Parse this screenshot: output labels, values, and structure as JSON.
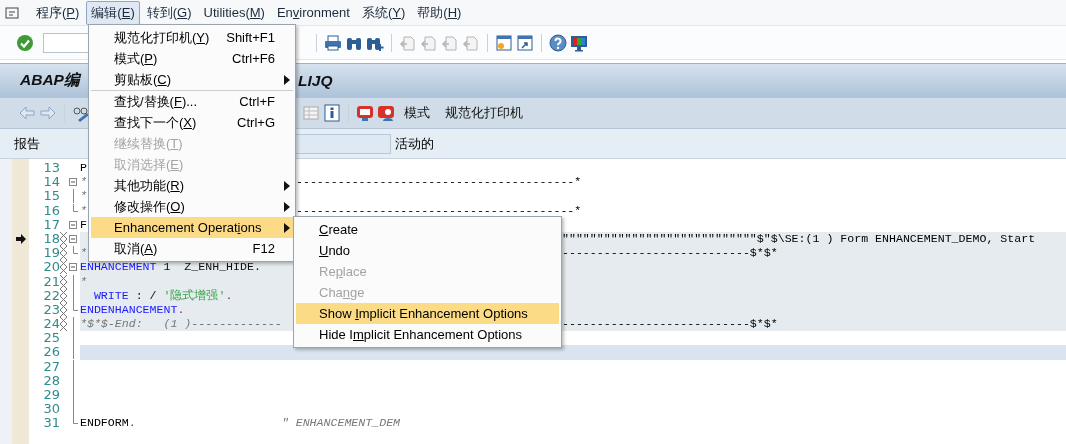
{
  "menu_bar": {
    "items": [
      {
        "before": "程序(",
        "key": "P",
        "after": ")",
        "selected": false
      },
      {
        "before": "编辑(",
        "key": "E",
        "after": ")",
        "selected": true
      },
      {
        "before": "转到(",
        "key": "G",
        "after": ")",
        "selected": false
      },
      {
        "before": "Utilities(",
        "key": "M",
        "after": ")",
        "selected": false
      },
      {
        "before": "En",
        "key": "v",
        "after": "ironment",
        "selected": false
      },
      {
        "before": "系统(",
        "key": "Y",
        "after": ")",
        "selected": false
      },
      {
        "before": "帮助(",
        "key": "H",
        "after": ")",
        "selected": false
      }
    ]
  },
  "title": {
    "start": "ABAP编",
    "end": "LIJQ"
  },
  "app_toolbar": {
    "buttons": [
      "模式",
      "规范化打印机"
    ]
  },
  "header": {
    "label": "报告",
    "status": "活动的"
  },
  "editor": {
    "lines": [
      {
        "number": "13",
        "segments": [
          {
            "text": "P",
            "kind": "bold"
          }
        ]
      },
      {
        "number": "14",
        "fold": {
          "kind": "open"
        },
        "segments": [
          {
            "text": "*",
            "kind": "comment"
          }
        ],
        "tail": {
          "text": "----------------------------------------*",
          "kind": "near"
        }
      },
      {
        "number": "15",
        "fold": {
          "kind": "line"
        },
        "segments": [
          {
            "text": "*",
            "kind": "comment"
          }
        ]
      },
      {
        "number": "16",
        "fold": {
          "kind": "end"
        },
        "segments": [
          {
            "text": "*",
            "kind": "comment"
          }
        ],
        "tail": {
          "text": "----------------------------------------*",
          "kind": "near"
        }
      },
      {
        "number": "17",
        "fold": {
          "kind": "open"
        },
        "segments": [
          {
            "text": "F",
            "kind": "bold"
          }
        ]
      },
      {
        "number": "18",
        "fold": {
          "kind": "open"
        },
        "marker": true,
        "enhancement": true,
        "tail": {
          "text": "\"\"\"\"\"\"\"\"\"\"\"\"\"\"\"\"\"\"\"\"\"\"\"\"\"\"\"\"$\"$\\SE:(1 ) Form ENHANCEMENT_DEMO, Start",
          "kind": "far"
        }
      },
      {
        "number": "19",
        "fold": {
          "kind": "end"
        },
        "enhancement": true,
        "segments": [
          {
            "text": "*",
            "kind": "comment"
          }
        ],
        "tail": {
          "text": "---------------------------$*$*",
          "kind": "far"
        }
      },
      {
        "number": "20",
        "fold": {
          "kind": "open"
        },
        "enhancement": true,
        "segments": [
          {
            "text": "ENHANCEMENT",
            "kind": "keyword"
          },
          {
            "text": " 1  Z_ENH_HIDE.",
            "kind": "plain"
          }
        ]
      },
      {
        "number": "21",
        "fold": {
          "kind": "line"
        },
        "enhancement": true,
        "segments": [
          {
            "text": "*",
            "kind": "comment"
          }
        ]
      },
      {
        "number": "22",
        "fold": {
          "kind": "line"
        },
        "enhancement": true,
        "segments": [
          {
            "text": "  WRITE",
            "kind": "keyword"
          },
          {
            "text": " : / ",
            "kind": "plain"
          },
          {
            "text": "'隐式增强'",
            "kind": "string"
          },
          {
            "text": ".",
            "kind": "punct"
          }
        ]
      },
      {
        "number": "23",
        "fold": {
          "kind": "end"
        },
        "enhancement": true,
        "segments": [
          {
            "text": "ENDENHANCEMENT",
            "kind": "keyword"
          },
          {
            "text": ".",
            "kind": "punct"
          }
        ]
      },
      {
        "number": "24",
        "fold": {
          "kind": "line"
        },
        "enhancement": true,
        "segments": [
          {
            "text": "*$*$-End:   (1 )-------------",
            "kind": "comment"
          }
        ],
        "tail": {
          "text": "---------------------------$*$*",
          "kind": "far"
        }
      },
      {
        "number": "25",
        "fold": {
          "kind": "line"
        }
      },
      {
        "number": "26",
        "fold": {
          "kind": "line"
        },
        "cursor": true
      },
      {
        "number": "27",
        "fold": {
          "kind": "line"
        }
      },
      {
        "number": "28",
        "fold": {
          "kind": "line"
        }
      },
      {
        "number": "29",
        "fold": {
          "kind": "line"
        }
      },
      {
        "number": "30",
        "fold": {
          "kind": "line"
        }
      },
      {
        "number": "31",
        "fold": {
          "kind": "end"
        },
        "segments": [
          {
            "text": "ENDFORM",
            "kind": "bold"
          },
          {
            "text": ".",
            "kind": "punct"
          },
          {
            "text": "                     \" ENHANCEMENT_DEM",
            "kind": "comment"
          }
        ]
      }
    ]
  },
  "edit_menu": {
    "groups": [
      [
        {
          "before": "规范化打印机(",
          "key": "Y",
          "after": ")",
          "shortcut": "Shift+F1",
          "has_submenu": false,
          "disabled": false,
          "selected": false
        },
        {
          "before": "模式(",
          "key": "P",
          "after": ")",
          "shortcut": "Ctrl+F6",
          "has_submenu": false,
          "disabled": false,
          "selected": false
        },
        {
          "before": "剪贴板(",
          "key": "C",
          "after": ")",
          "has_submenu": true,
          "disabled": false,
          "selected": false
        }
      ],
      [
        {
          "before": "查找/替换(",
          "key": "F",
          "after": ")...",
          "shortcut": "Ctrl+F",
          "has_submenu": false,
          "disabled": false,
          "selected": false
        },
        {
          "before": "查找下一个(",
          "key": "X",
          "after": ")",
          "shortcut": "Ctrl+G",
          "has_submenu": false,
          "disabled": false,
          "selected": false
        },
        {
          "before": "继续替换(",
          "key": "T",
          "after": ")",
          "has_submenu": false,
          "disabled": true,
          "selected": false
        },
        {
          "before": "取消选择(",
          "key": "E",
          "after": ")",
          "has_submenu": false,
          "disabled": true,
          "selected": false
        },
        {
          "before": "其他功能(",
          "key": "R",
          "after": ")",
          "has_submenu": true,
          "disabled": false,
          "selected": false
        },
        {
          "before": "修改操作(",
          "key": "O",
          "after": ")",
          "has_submenu": true,
          "disabled": false,
          "selected": false
        },
        {
          "before": "Enhancement Operat",
          "key": "i",
          "after": "ons",
          "has_submenu": true,
          "disabled": false,
          "selected": true
        },
        {
          "before": "取消(",
          "key": "A",
          "after": ")",
          "shortcut": "F12",
          "has_submenu": false,
          "disabled": false,
          "selected": false
        }
      ]
    ]
  },
  "submenu": {
    "items": [
      {
        "key": "C",
        "after": "reate",
        "disabled": false,
        "selected": false
      },
      {
        "key": "U",
        "after": "ndo",
        "disabled": false,
        "selected": false
      },
      {
        "before": "Re",
        "key": "p",
        "after": "lace",
        "disabled": true,
        "selected": false
      },
      {
        "before": "Cha",
        "key": "n",
        "after": "ge",
        "disabled": true,
        "selected": false
      },
      {
        "before": "Show ",
        "key": "I",
        "after": "mplicit Enhancement Options",
        "disabled": false,
        "selected": true
      },
      {
        "before": "Hide I",
        "key": "m",
        "after": "plicit Enhancement Options",
        "disabled": false,
        "selected": false
      }
    ]
  }
}
